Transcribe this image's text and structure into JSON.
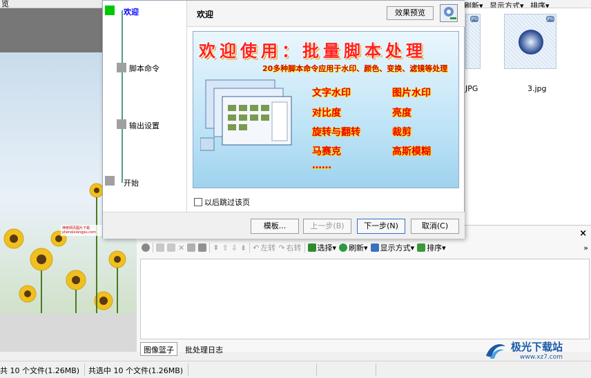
{
  "topbar": {
    "title": "览"
  },
  "top_toolbar": {
    "items": [
      "刷新▾",
      "显示方式▾",
      "排序▾"
    ]
  },
  "thumbnails": [
    {
      "caption": "JPG",
      "badge": "JPG"
    },
    {
      "caption": "3.jpg",
      "badge": "JPG"
    }
  ],
  "wizard": {
    "steps": [
      {
        "label": "欢迎"
      },
      {
        "label": "脚本命令"
      },
      {
        "label": "输出设置"
      },
      {
        "label": "开始"
      }
    ],
    "title": "欢迎",
    "preview_button": "效果预览",
    "banner": {
      "title": "欢迎使用：批量脚本处理",
      "subtitle": "20多种脚本命令应用于水印、颜色、变换、滤镜等处理",
      "features": [
        "文字水印",
        "图片水印",
        "对比度",
        "亮度",
        "旋转与翻转",
        "裁剪",
        "马赛克",
        "高斯模糊",
        "……"
      ]
    },
    "skip_checkbox": "以后跳过该页",
    "buttons": {
      "template": "模板...",
      "prev": "上一步(B)",
      "next": "下一步(N)",
      "cancel": "取消(C)"
    }
  },
  "basket": {
    "close": "×",
    "more": "»",
    "toolbar": {
      "rotate_left": "左转",
      "rotate_right": "右转",
      "select": "选择▾",
      "refresh": "刷新▾",
      "display": "显示方式▾",
      "sort": "排序▾"
    },
    "tabs": [
      "图像篮子",
      "批处理日志"
    ]
  },
  "statusbar": {
    "left": "共 10 个文件(1.26MB)",
    "selected": "共选中 10 个文件(1.26MB)"
  },
  "watermark": {
    "brand": "极光下载站",
    "url": "www.xz7.com"
  },
  "photo_watermark": {
    "line1": "神奇网页图片下载",
    "line2": "shenqixiangpu.com"
  },
  "colors": {
    "accent": "#3070c8",
    "step_active": "#00c800",
    "banner_red": "#ff2020"
  }
}
